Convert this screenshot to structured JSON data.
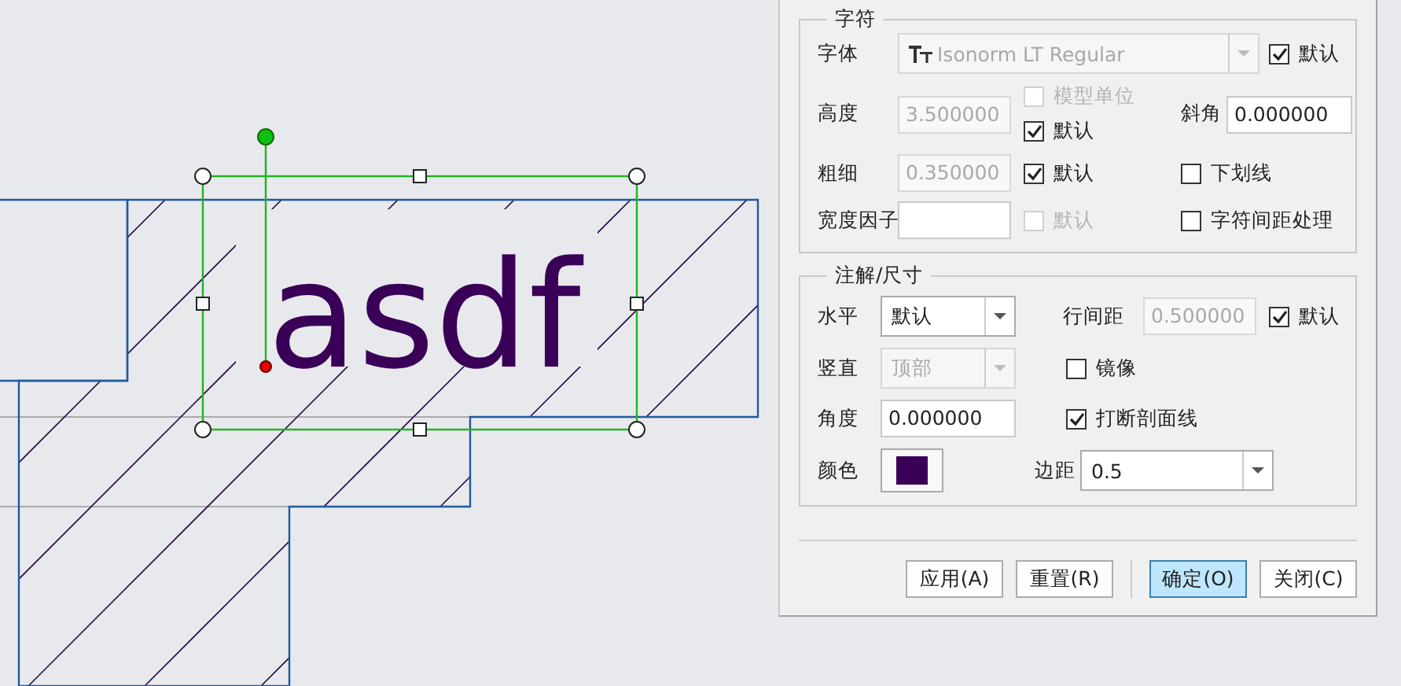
{
  "canvas": {
    "text": "asdf"
  },
  "character": {
    "legend": "字符",
    "font": {
      "label": "字体",
      "value": "Isonorm LT Regular",
      "disabled": true
    },
    "font_default": {
      "label": "默认",
      "checked": true,
      "disabled": false
    },
    "height": {
      "label": "高度",
      "value": "3.500000",
      "disabled": true
    },
    "model_units": {
      "label": "模型单位",
      "checked": false,
      "disabled": true
    },
    "height_default": {
      "label": "默认",
      "checked": true,
      "disabled": false
    },
    "slant": {
      "label": "斜角",
      "value": "0.000000",
      "disabled": false
    },
    "weight": {
      "label": "粗细",
      "value": "0.350000",
      "disabled": true
    },
    "weight_default": {
      "label": "默认",
      "checked": true,
      "disabled": false
    },
    "underline": {
      "label": "下划线",
      "checked": false,
      "disabled": false
    },
    "width_factor": {
      "label": "宽度因子",
      "disabled": false
    },
    "width_default": {
      "label": "默认",
      "checked": false,
      "disabled": true
    },
    "kerning": {
      "label": "字符间距处理",
      "checked": false,
      "disabled": false
    }
  },
  "annotation": {
    "legend": "注解/尺寸",
    "horizontal": {
      "label": "水平",
      "value": "默认",
      "disabled": false
    },
    "line_spacing": {
      "label": "行间距",
      "value": "0.500000",
      "disabled": true
    },
    "line_spacing_default": {
      "label": "默认",
      "checked": true,
      "disabled": false
    },
    "vertical": {
      "label": "竖直",
      "value": "顶部",
      "disabled": true
    },
    "mirror": {
      "label": "镜像",
      "checked": false,
      "disabled": false
    },
    "angle": {
      "label": "角度",
      "value": "0.000000",
      "disabled": false
    },
    "break_hatch": {
      "label": "打断剖面线",
      "checked": true,
      "disabled": false
    },
    "color": {
      "label": "颜色",
      "color": "#3a0058"
    },
    "margin": {
      "label": "边距",
      "value": "0.5",
      "disabled": false
    }
  },
  "buttons": [
    {
      "label": "应用(A)",
      "default": false
    },
    {
      "label": "重置(R)",
      "default": false
    },
    {
      "label": "确定(O)",
      "default": true
    },
    {
      "label": "关闭(C)",
      "default": false
    }
  ]
}
